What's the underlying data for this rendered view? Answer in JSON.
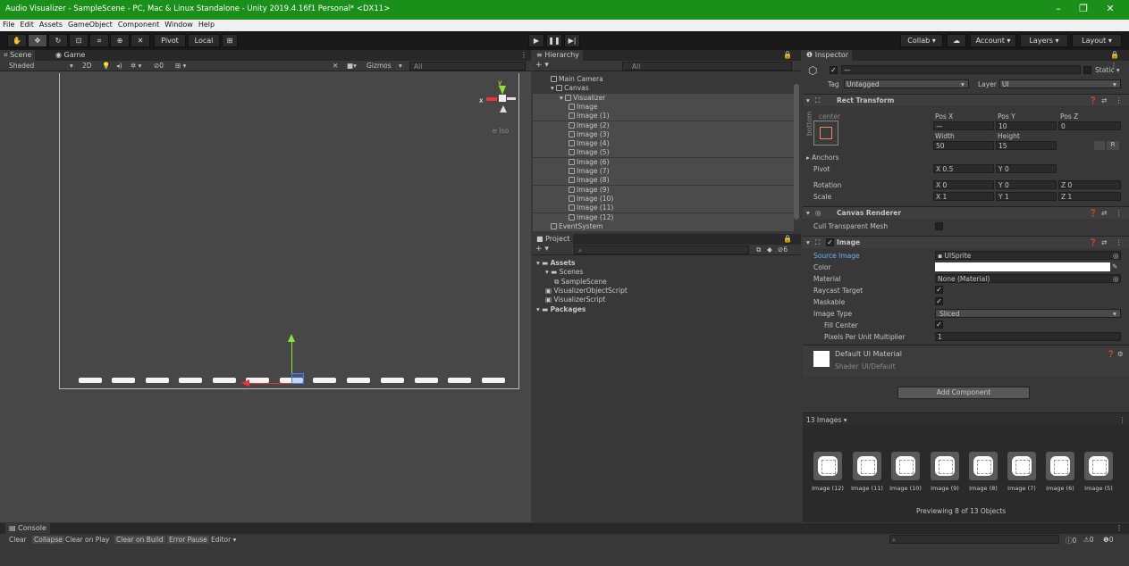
{
  "window": {
    "title": "Audio Visualizer - SampleScene - PC, Mac & Linux Standalone - Unity 2019.4.16f1 Personal* <DX11>",
    "minimize": "–",
    "maximize": "❐",
    "close": "✕"
  },
  "menu": [
    "File",
    "Edit",
    "Assets",
    "GameObject",
    "Component",
    "Window",
    "Help"
  ],
  "toolbar": {
    "pivot": "Pivot",
    "local": "Local",
    "collab": "Collab ▾",
    "account": "Account",
    "layers": "Layers",
    "layout": "Layout"
  },
  "scene": {
    "tab_scene": "Scene",
    "tab_game": "Game",
    "shading": "Shaded",
    "mode_2d": "2D",
    "gizmos": "Gizmos",
    "search_placeholder": "All",
    "iso": "Iso",
    "axis_x": "x",
    "axis_y": "y"
  },
  "hierarchy": {
    "tab": "Hierarchy",
    "add": "+ ▾",
    "search_placeholder": "All",
    "items": [
      {
        "label": "Main Camera",
        "indent": 1
      },
      {
        "label": "Canvas",
        "indent": 1
      },
      {
        "label": "Visualizer",
        "indent": 2
      },
      {
        "label": "Image",
        "indent": 3
      },
      {
        "label": "Image (1)",
        "indent": 3
      },
      {
        "label": "Image (2)",
        "indent": 3
      },
      {
        "label": "Image (3)",
        "indent": 3
      },
      {
        "label": "Image (4)",
        "indent": 3
      },
      {
        "label": "Image (5)",
        "indent": 3
      },
      {
        "label": "Image (6)",
        "indent": 3
      },
      {
        "label": "Image (7)",
        "indent": 3
      },
      {
        "label": "Image (8)",
        "indent": 3
      },
      {
        "label": "Image (9)",
        "indent": 3
      },
      {
        "label": "Image (10)",
        "indent": 3
      },
      {
        "label": "Image (11)",
        "indent": 3
      },
      {
        "label": "Image (12)",
        "indent": 3
      },
      {
        "label": "EventSystem",
        "indent": 1
      }
    ]
  },
  "project": {
    "tab": "Project",
    "add": "+ ▾",
    "hidden_count": "6",
    "items": [
      {
        "label": "Assets",
        "indent": 0,
        "bold": true
      },
      {
        "label": "Scenes",
        "indent": 1
      },
      {
        "label": "SampleScene",
        "indent": 2
      },
      {
        "label": "VisualizerObjectScript",
        "indent": 1
      },
      {
        "label": "VisualizerScript",
        "indent": 1
      },
      {
        "label": "Packages",
        "indent": 0,
        "bold": true
      }
    ]
  },
  "inspector": {
    "tab": "Inspector",
    "name": "—",
    "static": "Static ▾",
    "tag_label": "Tag",
    "tag_value": "Untagged",
    "layer_label": "Layer",
    "layer_value": "UI",
    "rect": {
      "title": "Rect Transform",
      "anchor_h": "center",
      "anchor_v": "bottom",
      "posx_label": "Pos X",
      "posx": "—",
      "posy_label": "Pos Y",
      "posy": "10",
      "posz_label": "Pos Z",
      "posz": "0",
      "width_label": "Width",
      "width": "50",
      "height_label": "Height",
      "height": "15",
      "anchors": "Anchors",
      "pivot_label": "Pivot",
      "pivot_x": "0.5",
      "pivot_y": "0",
      "rotation_label": "Rotation",
      "rot_x": "0",
      "rot_y": "0",
      "rot_z": "0",
      "scale_label": "Scale",
      "scale_x": "1",
      "scale_y": "1",
      "scale_z": "1",
      "x": "X",
      "y": "Y",
      "z": "Z",
      "btn_r": "R"
    },
    "canvas_renderer": {
      "title": "Canvas Renderer",
      "cull": "Cull Transparent Mesh"
    },
    "image": {
      "title": "Image",
      "source_label": "Source Image",
      "source_value": "UISprite",
      "color_label": "Color",
      "material_label": "Material",
      "material_value": "None (Material)",
      "raycast_label": "Raycast Target",
      "maskable_label": "Maskable",
      "type_label": "Image Type",
      "type_value": "Sliced",
      "fill_label": "Fill Center",
      "ppu_label": "Pixels Per Unit Multiplier",
      "ppu_value": "1"
    },
    "material": {
      "name": "Default UI Material",
      "shader_label": "Shader",
      "shader_value": "UI/Default"
    },
    "add_component": "Add Component",
    "preview_header": "13 Images ▾",
    "thumbs": [
      "Image (12)",
      "Image (11)",
      "Image (10)",
      "Image (9)",
      "Image (8)",
      "Image (7)",
      "Image (6)",
      "Image (5)"
    ],
    "previewing": "Previewing 8 of 13 Objects"
  },
  "console": {
    "tab": "Console",
    "buttons": [
      "Clear",
      "Collapse",
      "Clear on Play",
      "Clear on Build",
      "Error Pause",
      "Editor ▾"
    ],
    "count_info": "0",
    "count_warn": "0",
    "count_error": "0"
  },
  "colors": {
    "titlebar": "#1a8f1a",
    "selection": "#4b4b4b",
    "source_image_label": "#6fb0ff"
  }
}
